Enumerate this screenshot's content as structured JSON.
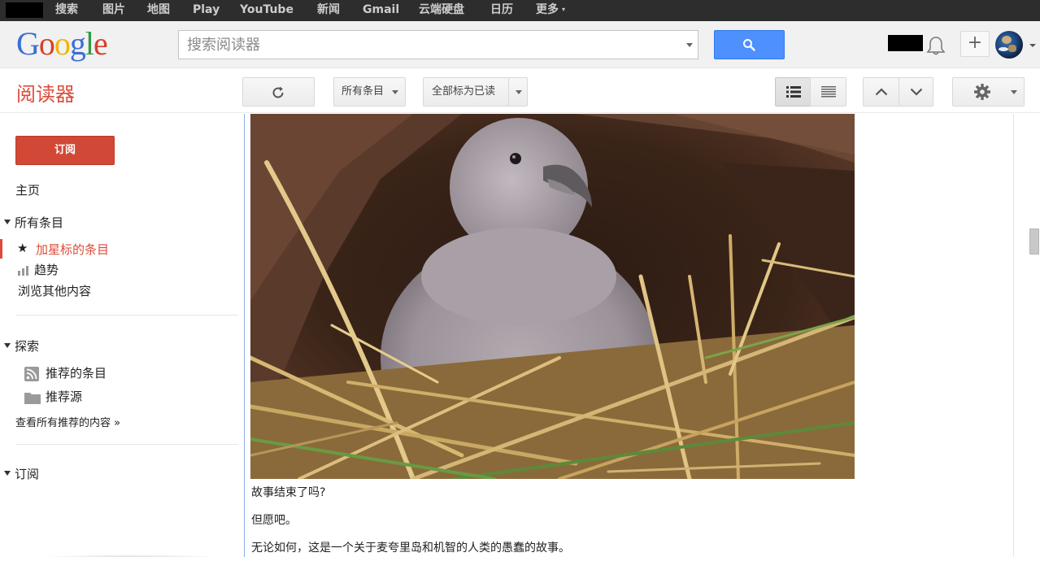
{
  "topbar": {
    "nav": [
      "搜索",
      "图片",
      "地图",
      "Play",
      "YouTube",
      "新闻",
      "Gmail",
      "云端硬盘",
      "日历",
      "更多"
    ]
  },
  "header": {
    "logo": [
      "G",
      "o",
      "o",
      "g",
      "l",
      "e"
    ],
    "logo_colors": [
      "#3b6fd4",
      "#d7402c",
      "#f2b500",
      "#3b6fd4",
      "#2f9a46",
      "#d7402c"
    ],
    "search_placeholder": "搜索阅读器",
    "share_plus": "+"
  },
  "toolbar": {
    "app_title": "阅读器",
    "filter_label": "所有条目",
    "mark_all_read": "全部标为已读"
  },
  "sidebar": {
    "subscribe": "订阅",
    "home": "主页",
    "all_items": "所有条目",
    "starred": "加星标的条目",
    "trends": "趋势",
    "browse": "浏览其他内容",
    "explore": "探索",
    "recommended_items": "推荐的条目",
    "recommended_sources": "推荐源",
    "view_all": "查看所有推荐的内容 »",
    "subscriptions": "订阅"
  },
  "article": {
    "paragraphs": [
      "故事结束了吗?",
      "但愿吧。",
      "无论如何，这是一个关于麦夸里岛和机智的人类的愚蠢的故事。"
    ]
  },
  "colors": {
    "accent_red": "#dd4b39",
    "search_blue": "#4d90fe",
    "topbar": "#2d2d2d"
  }
}
